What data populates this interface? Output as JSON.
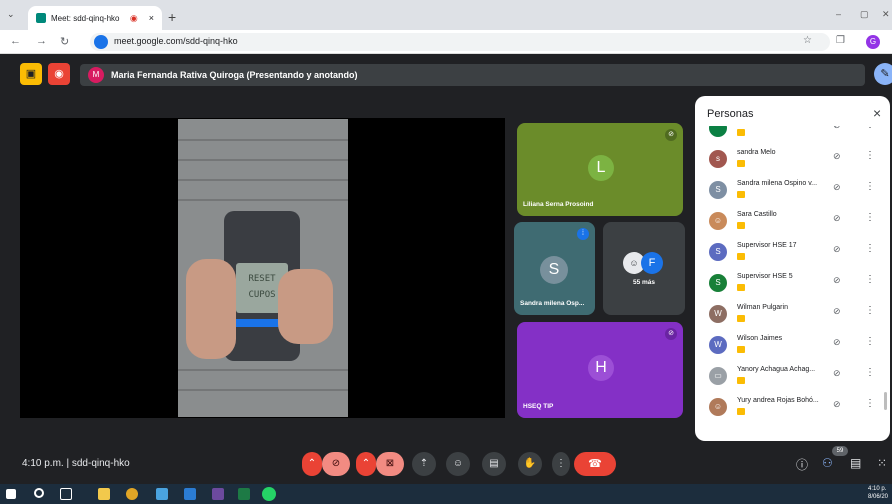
{
  "browser": {
    "tab_title": "Meet: sdd-qinq-hko",
    "tab_rec_icon": "record-dot-icon",
    "tab_close": "×",
    "new_tab": "+",
    "url": "meet.google.com/sdd-qinq-hko",
    "profile_initial": "G"
  },
  "meet": {
    "presenter_initial": "M",
    "presenter_text": "Maria Fernanda Rativa Quiroga (Presentando y anotando)",
    "screen_text_1": "RESET",
    "screen_text_2": "CUPOS",
    "tiles": [
      {
        "name": "Liliana Serna Prosoind",
        "initial": "L"
      },
      {
        "name": "Sandra milena Osp...",
        "initial": "S"
      },
      {
        "name": "55 más",
        "initial": "F"
      },
      {
        "name": "HSEQ TIP",
        "initial": "H"
      }
    ],
    "meeting_time": "4:10 p.m.",
    "separator": "|",
    "meeting_code": "sdd-qinq-hko",
    "participant_count": "59"
  },
  "people_panel": {
    "title": "Personas",
    "close_label": "×",
    "participants": [
      {
        "name": "",
        "initial": "",
        "color": "#0b8043"
      },
      {
        "name": "sandra Melo",
        "initial": "s",
        "color": "#a1574f"
      },
      {
        "name": "Sandra milena Ospino v...",
        "initial": "S",
        "color": "#7e8fa3"
      },
      {
        "name": "Sara Castillo",
        "initial": "",
        "color": "#c98a5a"
      },
      {
        "name": "Supervisor HSE 17",
        "initial": "S",
        "color": "#5c6bc0"
      },
      {
        "name": "Supervisor HSE 5",
        "initial": "S",
        "color": "#188038"
      },
      {
        "name": "Wilman Pulgarin",
        "initial": "W",
        "color": "#8d6e63"
      },
      {
        "name": "Wilson Jaimes",
        "initial": "W",
        "color": "#5c6bc0"
      },
      {
        "name": "Yanory Achagua Achag...",
        "initial": "",
        "color": "#9aa0a6"
      },
      {
        "name": "Yury andrea Rojas Bohó...",
        "initial": "",
        "color": "#b07a5a"
      }
    ]
  },
  "taskbar": {
    "time": "4:10 p.",
    "date": "8/06/20"
  },
  "colors": {
    "meet_dark": "#202124",
    "end_call": "#ea4335",
    "tile_green": "#6b8c2a",
    "tile_purple": "#8430c6",
    "tile_teal": "#3f6b72"
  }
}
